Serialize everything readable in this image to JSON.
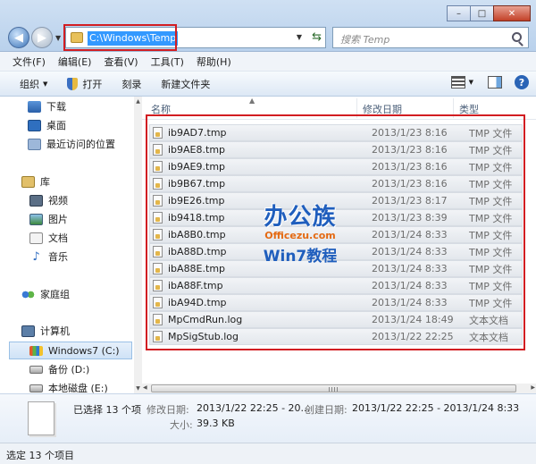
{
  "window": {
    "min_glyph": "–",
    "max_glyph": "□",
    "close_glyph": "✕"
  },
  "address": {
    "path": "C:\\Windows\\Temp",
    "dropdown_glyph": "▼",
    "refresh_glyph": "⇆"
  },
  "search": {
    "placeholder": "搜索 Temp"
  },
  "nav": {
    "back_glyph": "◀",
    "forward_glyph": "▶",
    "history_glyph": "▼"
  },
  "menu": [
    {
      "label": "文件(F)"
    },
    {
      "label": "编辑(E)"
    },
    {
      "label": "查看(V)"
    },
    {
      "label": "工具(T)"
    },
    {
      "label": "帮助(H)"
    }
  ],
  "toolbar": {
    "organize": "组织",
    "open": "打开",
    "burn": "刻录",
    "new_folder": "新建文件夹",
    "arrow_glyph": "▼",
    "help_glyph": "?"
  },
  "sidebar": {
    "items": [
      {
        "label": "下载",
        "icon": "download-icon"
      },
      {
        "label": "桌面",
        "icon": "desktop-icon"
      },
      {
        "label": "最近访问的位置",
        "icon": "recent-places-icon"
      },
      {
        "label": "库",
        "icon": "library-icon"
      },
      {
        "label": "视频",
        "icon": "video-icon"
      },
      {
        "label": "图片",
        "icon": "picture-icon"
      },
      {
        "label": "文档",
        "icon": "document-icon"
      },
      {
        "label": "音乐",
        "icon": "music-icon"
      },
      {
        "label": "家庭组",
        "icon": "homegroup-icon"
      },
      {
        "label": "计算机",
        "icon": "computer-icon"
      },
      {
        "label": "Windows7 (C:)",
        "icon": "windows-drive-icon"
      },
      {
        "label": "备份 (D:)",
        "icon": "drive-icon"
      },
      {
        "label": "本地磁盘 (E:)",
        "icon": "drive-icon"
      }
    ],
    "music_glyph": "♪",
    "scroll_up_glyph": "▲",
    "scroll_down_glyph": "▼"
  },
  "columns": {
    "name": "名称",
    "modified": "修改日期",
    "type": "类型",
    "sort_glyph": "▲"
  },
  "files": [
    {
      "name": "ib9AD7.tmp",
      "date": "2013/1/23 8:16",
      "type": "TMP 文件"
    },
    {
      "name": "ib9AE8.tmp",
      "date": "2013/1/23 8:16",
      "type": "TMP 文件"
    },
    {
      "name": "ib9AE9.tmp",
      "date": "2013/1/23 8:16",
      "type": "TMP 文件"
    },
    {
      "name": "ib9B67.tmp",
      "date": "2013/1/23 8:16",
      "type": "TMP 文件"
    },
    {
      "name": "ib9E26.tmp",
      "date": "2013/1/23 8:17",
      "type": "TMP 文件"
    },
    {
      "name": "ib9418.tmp",
      "date": "2013/1/23 8:39",
      "type": "TMP 文件"
    },
    {
      "name": "ibA8B0.tmp",
      "date": "2013/1/24 8:33",
      "type": "TMP 文件"
    },
    {
      "name": "ibA88D.tmp",
      "date": "2013/1/24 8:33",
      "type": "TMP 文件"
    },
    {
      "name": "ibA88E.tmp",
      "date": "2013/1/24 8:33",
      "type": "TMP 文件"
    },
    {
      "name": "ibA88F.tmp",
      "date": "2013/1/24 8:33",
      "type": "TMP 文件"
    },
    {
      "name": "ibA94D.tmp",
      "date": "2013/1/24 8:33",
      "type": "TMP 文件"
    },
    {
      "name": "MpCmdRun.log",
      "date": "2013/1/24 18:49",
      "type": "文本文档"
    },
    {
      "name": "MpSigStub.log",
      "date": "2013/1/22 22:25",
      "type": "文本文档"
    }
  ],
  "watermark": {
    "brand_cn": "办公族",
    "brand_url": "Officezu.com",
    "tagline": "Win7教程"
  },
  "details": {
    "selected": "已选择 13 个项",
    "modified_label": "修改日期:",
    "modified_value": "2013/1/22 22:25 - 20...",
    "created_label": "创建日期:",
    "created_value": "2013/1/22 22:25 - 2013/1/24 8:33",
    "size_label": "大小:",
    "size_value": "39.3 KB"
  },
  "status": {
    "text": "选定 13 个项目"
  },
  "scroll": {
    "left_glyph": "◀",
    "right_glyph": "▶"
  }
}
